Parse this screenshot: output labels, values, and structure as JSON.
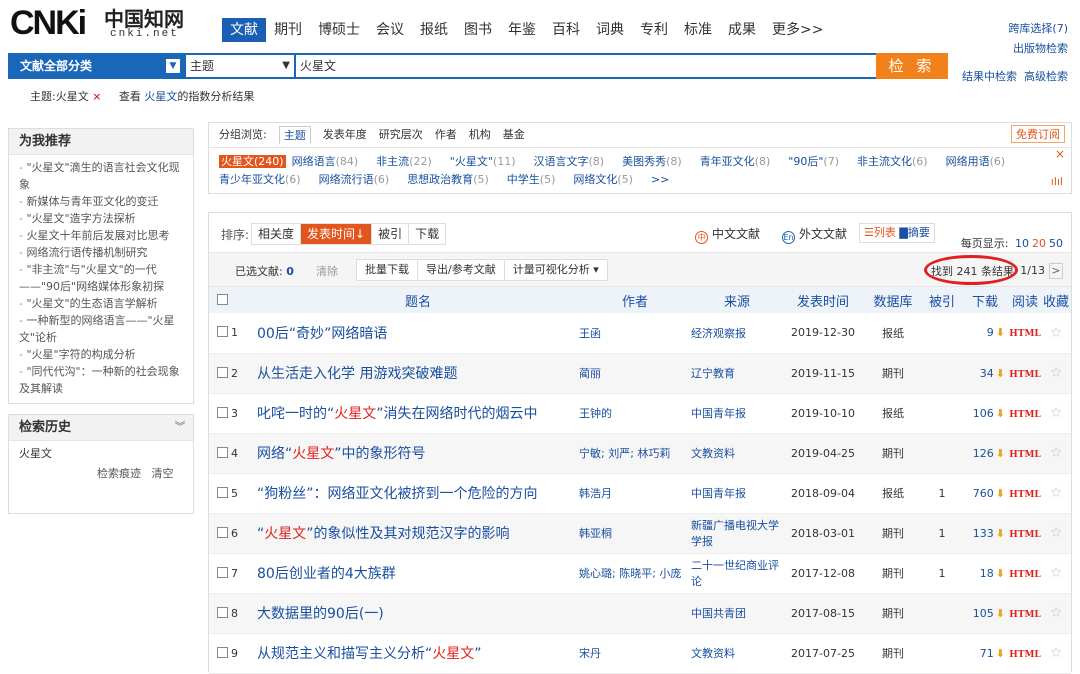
{
  "logo": {
    "brand": "CNKi",
    "name": "中国知网",
    "domain": "cnki.net"
  },
  "nav": {
    "tabs": [
      "文献",
      "期刊",
      "博硕士",
      "会议",
      "报纸",
      "图书",
      "年鉴",
      "百科",
      "词典",
      "专利",
      "标准",
      "成果",
      "更多>>"
    ],
    "active": 0,
    "cross_db": "跨库选择(7)",
    "pub_search": "出版物检索",
    "in_result": "结果中检索",
    "advanced": "高级检索"
  },
  "search": {
    "category": "文献全部分类",
    "field": "主题",
    "query": "火星文",
    "button": "检 索"
  },
  "crumb": {
    "topic": "主题:火星文",
    "close": "×",
    "view_prefix": "查看",
    "view_term": "火星文",
    "view_suffix": "的指数分析结果"
  },
  "sidebar": {
    "recommend_title": "为我推荐",
    "recommend": [
      "\"火星文\"滴生的语言社会文化现象",
      "新媒体与青年亚文化的变迁",
      "\"火星文\"造字方法探析",
      "火星文十年前后发展对比思考",
      "网络流行语传播机制研究",
      "\"非主流\"与\"火星文\"的一代——\"90后\"网络媒体形象初探",
      "\"火星文\"的生态语言学解析",
      "一种新型的网络语言——\"火星文\"论析",
      "\"火星\"字符的构成分析",
      "\"同代代沟\"：一种新的社会现象及其解读"
    ],
    "history_title": "检索历史",
    "history_item": "火星文",
    "history_trace": "检索痕迹",
    "history_clear": "清空"
  },
  "group": {
    "label": "分组浏览:",
    "tabs": [
      "主题",
      "发表年度",
      "研究层次",
      "作者",
      "机构",
      "基金"
    ],
    "free_sub": "免费订阅",
    "tags": [
      {
        "name": "火星文",
        "count": "(240)"
      },
      {
        "name": "网络语言",
        "count": "(84)"
      },
      {
        "name": "非主流",
        "count": "(22)"
      },
      {
        "name": "\"火星文\"",
        "count": "(11)"
      },
      {
        "name": "汉语言文字",
        "count": "(8)"
      },
      {
        "name": "美图秀秀",
        "count": "(8)"
      },
      {
        "name": "青年亚文化",
        "count": "(8)"
      },
      {
        "name": "\"90后\"",
        "count": "(7)"
      },
      {
        "name": "非主流文化",
        "count": "(6)"
      },
      {
        "name": "网络用语",
        "count": "(6)"
      },
      {
        "name": "青少年亚文化",
        "count": "(6)"
      },
      {
        "name": "网络流行语",
        "count": "(6)"
      },
      {
        "name": "思想政治教育",
        "count": "(5)"
      },
      {
        "name": "中学生",
        "count": "(5)"
      },
      {
        "name": "网络文化",
        "count": "(5)"
      },
      {
        "name": ">>",
        "count": ""
      }
    ],
    "close": "×"
  },
  "results": {
    "sort_label": "排序:",
    "sort": [
      "相关度",
      "发表时间↓",
      "被引",
      "下载"
    ],
    "sort_active": 1,
    "cn": "中文文献",
    "en": "外文文献",
    "view_list": "☰列表",
    "view_abs": "▇摘要",
    "per_page_label": "每页显示:",
    "per_page": [
      "10",
      "20",
      "50"
    ],
    "per_page_active": 1,
    "selected_label": "已选文献:",
    "selected_count": "0",
    "clear": "清除",
    "batch": [
      "批量下载",
      "导出/参考文献",
      "计量可视化分析 ▾"
    ],
    "found": "找到 241 条结果",
    "page": "1/13",
    "next": ">",
    "headers": [
      "题名",
      "作者",
      "来源",
      "发表时间",
      "数据库",
      "被引",
      "下载",
      "阅读",
      "收藏"
    ],
    "rows": [
      {
        "n": "1",
        "title_pre": "00后“奇妙”网络暗语",
        "title_hl": "",
        "title_post": "",
        "author": "王函",
        "source": "经济观察报",
        "date": "2019-12-30",
        "db": "报纸",
        "cite": "",
        "dl": "9"
      },
      {
        "n": "2",
        "title_pre": "从生活走入化学 用游戏突破难题",
        "title_hl": "",
        "title_post": "",
        "author": "蔺丽",
        "source": "辽宁教育",
        "date": "2019-11-15",
        "db": "期刊",
        "cite": "",
        "dl": "34"
      },
      {
        "n": "3",
        "title_pre": "叱咤一时的“",
        "title_hl": "火星文",
        "title_post": "”消失在网络时代的烟云中",
        "author": "王钟的",
        "source": "中国青年报",
        "date": "2019-10-10",
        "db": "报纸",
        "cite": "",
        "dl": "106"
      },
      {
        "n": "4",
        "title_pre": "网络“",
        "title_hl": "火星文",
        "title_post": "”中的象形符号",
        "author": "宁敏; 刘严; 林巧莉",
        "source": "文教资料",
        "date": "2019-04-25",
        "db": "期刊",
        "cite": "",
        "dl": "126"
      },
      {
        "n": "5",
        "title_pre": "“狗粉丝”：网络亚文化被挤到一个危险的方向",
        "title_hl": "",
        "title_post": "",
        "author": "韩浩月",
        "source": "中国青年报",
        "date": "2018-09-04",
        "db": "报纸",
        "cite": "1",
        "dl": "760"
      },
      {
        "n": "6",
        "title_pre": "“",
        "title_hl": "火星文",
        "title_post": "”的象似性及其对规范汉字的影响",
        "author": "韩亚桐",
        "source": "新疆广播电视大学学报",
        "date": "2018-03-01",
        "db": "期刊",
        "cite": "1",
        "dl": "133"
      },
      {
        "n": "7",
        "title_pre": "80后创业者的4大族群",
        "title_hl": "",
        "title_post": "",
        "author": "姚心璐; 陈晓平; 小庞",
        "source": "二十一世纪商业评论",
        "date": "2017-12-08",
        "db": "期刊",
        "cite": "1",
        "dl": "18"
      },
      {
        "n": "8",
        "title_pre": "大数据里的90后(一)",
        "title_hl": "",
        "title_post": "",
        "author": "",
        "source": "中国共青团",
        "date": "2017-08-15",
        "db": "期刊",
        "cite": "",
        "dl": "105"
      },
      {
        "n": "9",
        "title_pre": "从规范主义和描写主义分析“",
        "title_hl": "火星文",
        "title_post": "”",
        "author": "宋丹",
        "source": "文教资料",
        "date": "2017-07-25",
        "db": "期刊",
        "cite": "",
        "dl": "71"
      }
    ],
    "html_label": "HTML",
    "star": "☆"
  }
}
